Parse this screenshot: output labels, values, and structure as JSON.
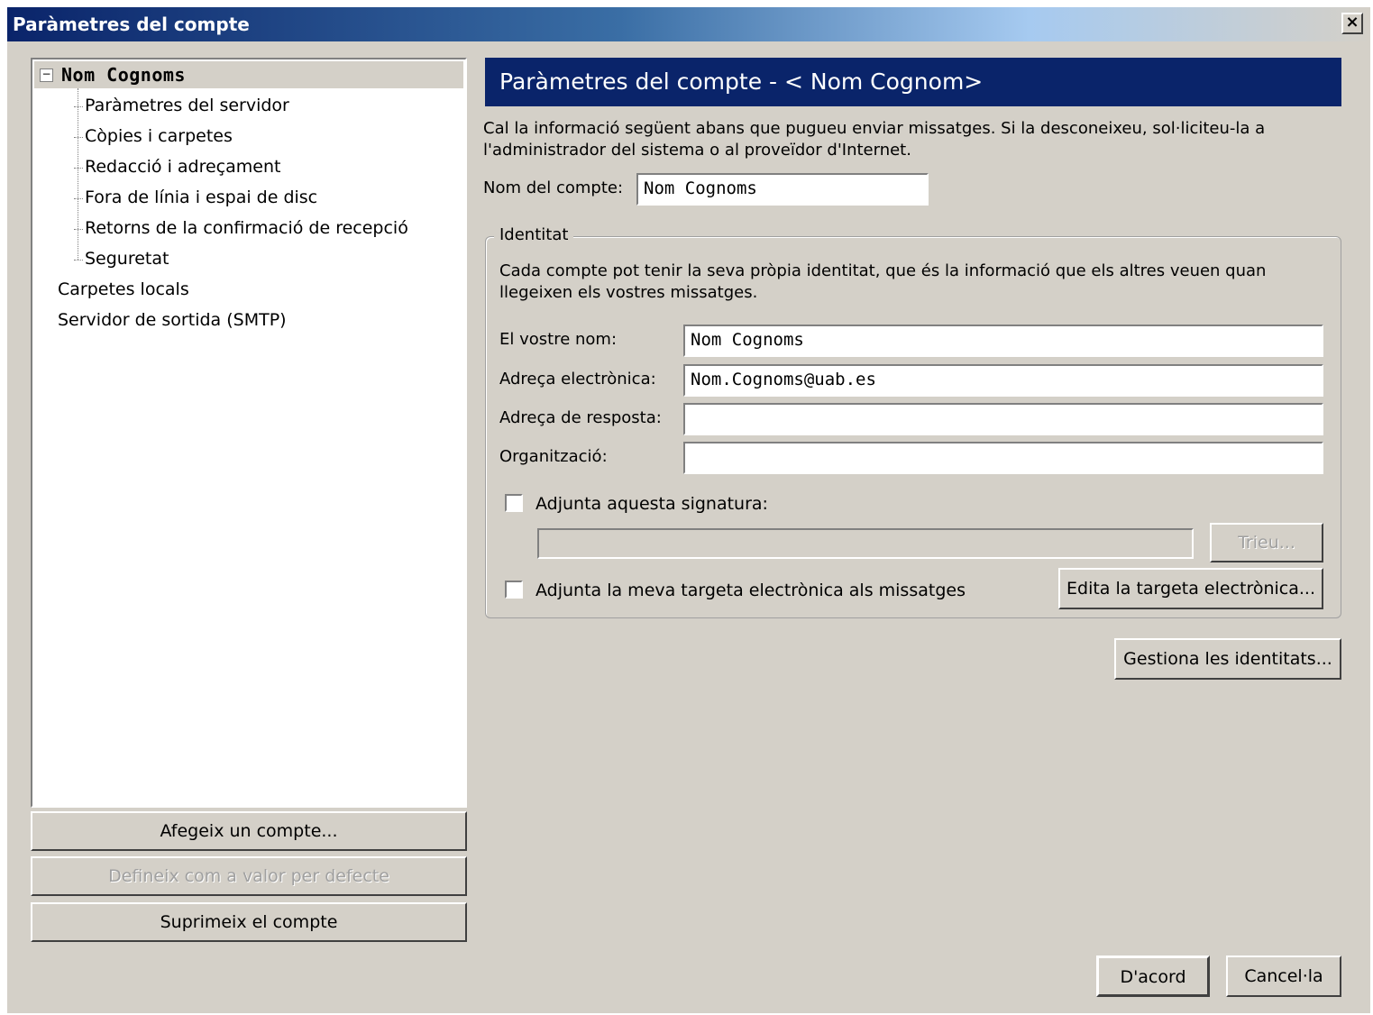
{
  "window": {
    "title": "Paràmetres del compte",
    "close": "×"
  },
  "tree": {
    "root": {
      "toggle": "−",
      "label": "Nom Cognoms"
    },
    "children": [
      "Paràmetres del servidor",
      "Còpies i carpetes",
      "Redacció i adreçament",
      "Fora de línia i espai de disc",
      "Retorns de la confirmació de recepció",
      "Seguretat"
    ],
    "others": [
      "Carpetes locals",
      "Servidor de sortida (SMTP)"
    ]
  },
  "left_buttons": {
    "add_account": "Afegeix un compte...",
    "set_default": "Defineix com a valor per defecte",
    "delete_account": "Suprimeix el compte"
  },
  "panel": {
    "header": "Paràmetres del compte - < Nom Cognom>",
    "intro_line1": "Cal la informació següent abans que pugueu enviar missatges. Si la desconeixeu, sol·liciteu-la a",
    "intro_line2": "l'administrador del sistema o al proveïdor d'Internet.",
    "account_name_label": "Nom del compte:",
    "account_name_value": "Nom Cognoms",
    "identity": {
      "title": "Identitat",
      "desc_line1": "Cada compte pot tenir la seva pròpia identitat, que és la informació que els altres veuen quan",
      "desc_line2": "llegeixen els vostres missatges.",
      "your_name_label": "El vostre nom:",
      "your_name_value": "Nom Cognoms",
      "email_label": "Adreça electrònica:",
      "email_value": "Nom.Cognoms@uab.es",
      "reply_label": "Adreça de resposta:",
      "reply_value": "",
      "org_label": "Organització:",
      "org_value": "",
      "signature_label": "Adjunta aquesta signatura:",
      "signature_value": "",
      "choose_button": "Trieu...",
      "vcard_label": "Adjunta la meva targeta electrònica als missatges",
      "edit_vcard_button": "Edita la targeta electrònica..."
    },
    "manage_identities_button": "Gestiona les identitats..."
  },
  "footer": {
    "ok": "D'acord",
    "cancel": "Cancel·la"
  }
}
